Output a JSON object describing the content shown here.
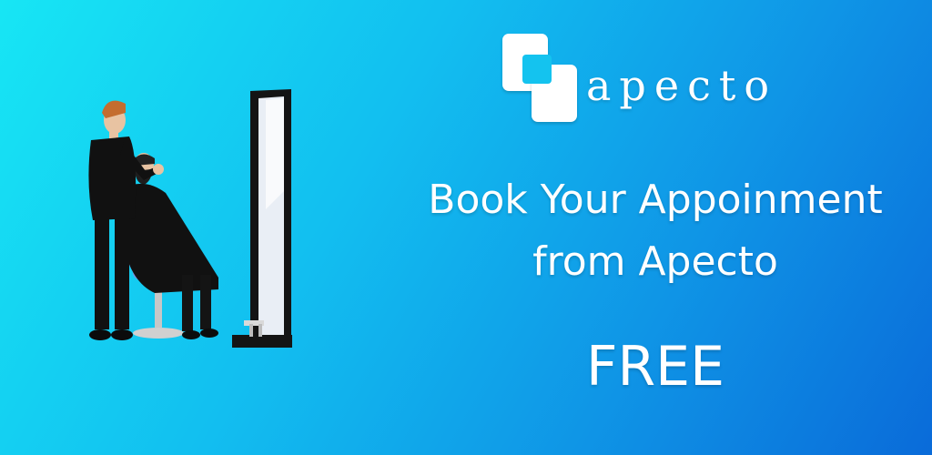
{
  "brand": {
    "name": "apecto"
  },
  "headline": {
    "line1": "Book Your Appoinment",
    "line2": "from Apecto"
  },
  "offer": {
    "label": "FREE"
  },
  "colors": {
    "gradient_start": "#17e6f4",
    "gradient_end": "#0a6bd9",
    "text": "#ffffff",
    "chair": "#7b93e6",
    "clothing": "#111111",
    "skin": "#e8c3a2",
    "hair": "#c46d2f"
  },
  "icons": {
    "logo": "stacked-squares-logo-icon",
    "illustration": "barber-cutting-hair-illustration"
  }
}
